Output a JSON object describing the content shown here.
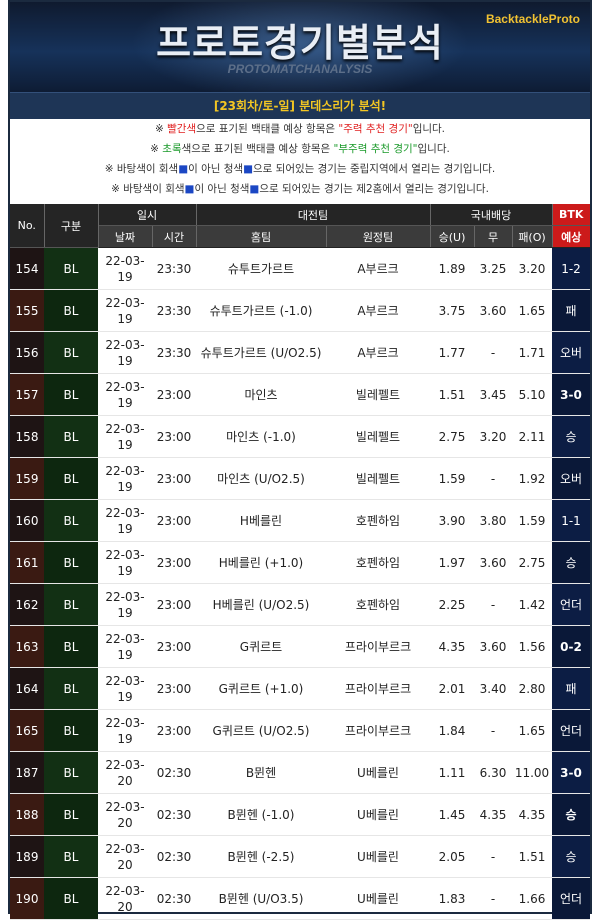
{
  "header": {
    "title": "프로토경기별분석",
    "subtitle": "PROTOMATCHANALYSIS",
    "brand": "BacktackleProto",
    "round": "[23회차/토-일] 분데스리가 분석!"
  },
  "notes": [
    {
      "pre": "※ ",
      "hl": "빨간색",
      "mid": "으로 표기된 백태클 예상 항목은 ",
      "hl2": "\"주력 추천 경기\"",
      "post": "입니다.",
      "color": "red"
    },
    {
      "pre": "※ ",
      "hl": "초록",
      "mid": "색으로 표기된 백태클 예상 항목은 ",
      "hl2": "\"부주력 추천 경기\"",
      "post": "입니다.",
      "color": "grn"
    },
    {
      "pre": "※ 바탕색이 회색",
      "hl": "■",
      "mid": "이 아닌 청색",
      "hl2": "■",
      "post": "으로 되어있는 경기는 중립지역에서 열리는 경기입니다.",
      "color": "blu"
    },
    {
      "pre": "※ 바탕색이 회색",
      "hl": "■",
      "mid": "이 아닌 청색",
      "hl2": "■",
      "post": "으로 되어있는 경기는 제2홈에서 열리는 경기입니다.",
      "color": "blu"
    }
  ],
  "table": {
    "headers": {
      "no": "No.",
      "gubun": "구분",
      "ilsi": "일시",
      "match": "대전팀",
      "odds": "국내배당",
      "btk": "BTK",
      "date": "날짜",
      "time": "시간",
      "home": "홈팀",
      "away": "원정팀",
      "win": "승(U)",
      "draw": "무",
      "lose": "패(O)",
      "pred": "예상"
    },
    "rows": [
      {
        "no": "154",
        "g": "BL",
        "date": "22-03-19",
        "time": "23:30",
        "home": "슈투트가르트",
        "away": "A부르크",
        "w": "1.89",
        "d": "3.25",
        "l": "3.20",
        "p": "1-2",
        "pc": "wht"
      },
      {
        "no": "155",
        "g": "BL",
        "date": "22-03-19",
        "time": "23:30",
        "home": "슈투트가르트 (-1.0)",
        "away": "A부르크",
        "w": "3.75",
        "d": "3.60",
        "l": "1.65",
        "p": "패",
        "pc": "grn"
      },
      {
        "no": "156",
        "g": "BL",
        "date": "22-03-19",
        "time": "23:30",
        "home": "슈투트가르트 (U/O2.5)",
        "away": "A부르크",
        "w": "1.77",
        "d": "-",
        "l": "1.71",
        "p": "오버",
        "pc": "wht"
      },
      {
        "no": "157",
        "g": "BL",
        "date": "22-03-19",
        "time": "23:00",
        "home": "마인츠",
        "away": "빌레펠트",
        "w": "1.51",
        "d": "3.45",
        "l": "5.10",
        "p": "3-0",
        "pc": "red"
      },
      {
        "no": "158",
        "g": "BL",
        "date": "22-03-19",
        "time": "23:00",
        "home": "마인츠 (-1.0)",
        "away": "빌레펠트",
        "w": "2.75",
        "d": "3.20",
        "l": "2.11",
        "p": "승",
        "pc": "wht"
      },
      {
        "no": "159",
        "g": "BL",
        "date": "22-03-19",
        "time": "23:00",
        "home": "마인츠 (U/O2.5)",
        "away": "빌레펠트",
        "w": "1.59",
        "d": "-",
        "l": "1.92",
        "p": "오버",
        "pc": "wht"
      },
      {
        "no": "160",
        "g": "BL",
        "date": "22-03-19",
        "time": "23:00",
        "home": "H베를린",
        "away": "호펜하임",
        "w": "3.90",
        "d": "3.80",
        "l": "1.59",
        "p": "1-1",
        "pc": "wht"
      },
      {
        "no": "161",
        "g": "BL",
        "date": "22-03-19",
        "time": "23:00",
        "home": "H베를린 (+1.0)",
        "away": "호펜하임",
        "w": "1.97",
        "d": "3.60",
        "l": "2.75",
        "p": "승",
        "pc": "wht"
      },
      {
        "no": "162",
        "g": "BL",
        "date": "22-03-19",
        "time": "23:00",
        "home": "H베를린 (U/O2.5)",
        "away": "호펜하임",
        "w": "2.25",
        "d": "-",
        "l": "1.42",
        "p": "언더",
        "pc": "wht"
      },
      {
        "no": "163",
        "g": "BL",
        "date": "22-03-19",
        "time": "23:00",
        "home": "G퀴르트",
        "away": "프라이부르크",
        "w": "4.35",
        "d": "3.60",
        "l": "1.56",
        "p": "0-2",
        "pc": "red"
      },
      {
        "no": "164",
        "g": "BL",
        "date": "22-03-19",
        "time": "23:00",
        "home": "G퀴르트 (+1.0)",
        "away": "프라이부르크",
        "w": "2.01",
        "d": "3.40",
        "l": "2.80",
        "p": "패",
        "pc": "wht"
      },
      {
        "no": "165",
        "g": "BL",
        "date": "22-03-19",
        "time": "23:00",
        "home": "G퀴르트 (U/O2.5)",
        "away": "프라이부르크",
        "w": "1.84",
        "d": "-",
        "l": "1.65",
        "p": "언더",
        "pc": "wht"
      },
      {
        "no": "187",
        "g": "BL",
        "date": "22-03-20",
        "time": "02:30",
        "home": "B뮌헨",
        "away": "U베를린",
        "w": "1.11",
        "d": "6.30",
        "l": "11.00",
        "p": "3-0",
        "pc": "red"
      },
      {
        "no": "188",
        "g": "BL",
        "date": "22-03-20",
        "time": "02:30",
        "home": "B뮌헨 (-1.0)",
        "away": "U베를린",
        "w": "1.45",
        "d": "4.35",
        "l": "4.35",
        "p": "승",
        "pc": "red"
      },
      {
        "no": "189",
        "g": "BL",
        "date": "22-03-20",
        "time": "02:30",
        "home": "B뮌헨 (-2.5)",
        "away": "U베를린",
        "w": "2.05",
        "d": "-",
        "l": "1.51",
        "p": "승",
        "pc": "wht"
      },
      {
        "no": "190",
        "g": "BL",
        "date": "22-03-20",
        "time": "02:30",
        "home": "B뮌헨 (U/O3.5)",
        "away": "U베를린",
        "w": "1.83",
        "d": "-",
        "l": "1.66",
        "p": "언더",
        "pc": "wht"
      }
    ]
  },
  "colors": {
    "accent_red": "#e02020",
    "accent_green": "#22b05a",
    "header_bg": "#252525",
    "btk_bg": "#0c1d44",
    "gubun_bg": "#123014",
    "banner_title": "#f3c623"
  }
}
